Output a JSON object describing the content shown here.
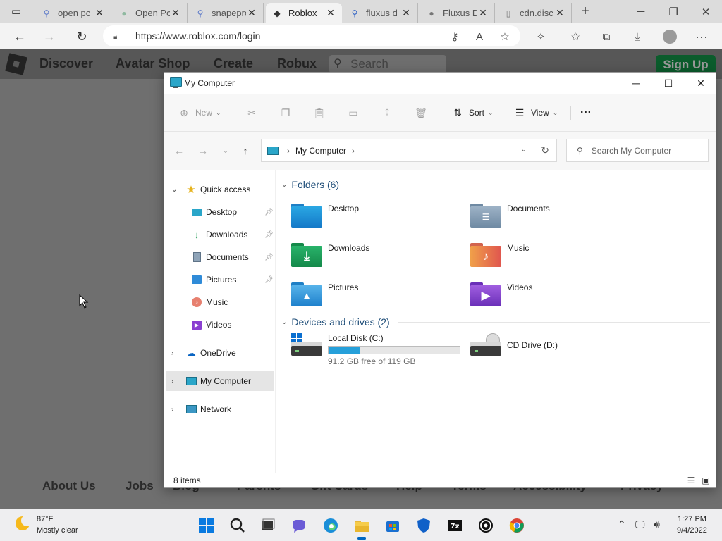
{
  "browser": {
    "tabs": [
      {
        "title": "open pc",
        "icon": "search-icon"
      },
      {
        "title": "Open Pc",
        "icon": "globe-icon"
      },
      {
        "title": "snapepro",
        "icon": "search-icon"
      },
      {
        "title": "Roblox",
        "icon": "roblox-icon",
        "active": true
      },
      {
        "title": "fluxus d",
        "icon": "search-icon"
      },
      {
        "title": "Fluxus D",
        "icon": "globe-icon"
      },
      {
        "title": "cdn.disc",
        "icon": "file-icon"
      }
    ],
    "url": "https://www.roblox.com/login"
  },
  "roblox": {
    "nav": [
      "Discover",
      "Avatar Shop",
      "Create",
      "Robux"
    ],
    "search_placeholder": "Search",
    "signup_label": "Sign Up",
    "footer": [
      "About Us",
      "Jobs",
      "Blog",
      "Parents",
      "Gift Cards",
      "Help",
      "Terms",
      "Accessibility",
      "Privacy"
    ]
  },
  "explorer": {
    "title": "My Computer",
    "cmd": {
      "new": "New",
      "sort": "Sort",
      "view": "View",
      "more": "···"
    },
    "breadcrumb": "My Computer",
    "search_placeholder": "Search My Computer",
    "sidebar": {
      "quick_access": "Quick access",
      "pinned": [
        "Desktop",
        "Downloads",
        "Documents",
        "Pictures",
        "Music",
        "Videos"
      ],
      "onedrive": "OneDrive",
      "mycomputer": "My Computer",
      "network": "Network"
    },
    "folders_header": "Folders (6)",
    "folders": [
      "Desktop",
      "Documents",
      "Downloads",
      "Music",
      "Pictures",
      "Videos"
    ],
    "drives_header": "Devices and drives (2)",
    "drives": [
      {
        "name": "Local Disk (C:)",
        "free": "91.2 GB free of 119 GB",
        "used_fraction": 0.234
      },
      {
        "name": "CD Drive (D:)"
      }
    ],
    "status": "8 items"
  },
  "taskbar": {
    "temp": "87°F",
    "condition": "Mostly clear",
    "time": "1:27 PM",
    "date": "9/4/2022"
  },
  "colors": {
    "accent": "#0067c0",
    "drive_bar": "#26a0da",
    "signup_green": "#0b5c2c"
  }
}
